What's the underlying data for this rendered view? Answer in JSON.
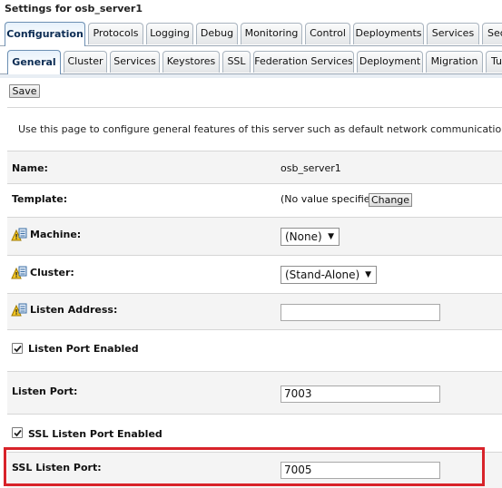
{
  "window": {
    "title": "Settings for osb_server1"
  },
  "tabs_primary": [
    {
      "label": "Configuration",
      "active": true
    },
    {
      "label": "Protocols",
      "active": false
    },
    {
      "label": "Logging",
      "active": false
    },
    {
      "label": "Debug",
      "active": false
    },
    {
      "label": "Monitoring",
      "active": false
    },
    {
      "label": "Control",
      "active": false
    },
    {
      "label": "Deployments",
      "active": false
    },
    {
      "label": "Services",
      "active": false
    },
    {
      "label": "Sec",
      "active": false
    }
  ],
  "tabs_secondary": [
    {
      "label": "General",
      "active": true
    },
    {
      "label": "Cluster",
      "active": false
    },
    {
      "label": "Services",
      "active": false
    },
    {
      "label": "Keystores",
      "active": false
    },
    {
      "label": "SSL",
      "active": false
    },
    {
      "label": "Federation Services",
      "active": false
    },
    {
      "label": "Deployment",
      "active": false
    },
    {
      "label": "Migration",
      "active": false
    },
    {
      "label": "Tu",
      "active": false
    }
  ],
  "toolbar": {
    "save_label": "Save"
  },
  "description": "Use this page to configure general features of this server such as default network communications.",
  "form": {
    "name": {
      "label": "Name:",
      "value": "osb_server1"
    },
    "template": {
      "label": "Template:",
      "value": "(No value specified)",
      "change_label": "Change"
    },
    "machine": {
      "label": "Machine:",
      "value": "(None)",
      "icon": "config-change-icon"
    },
    "cluster": {
      "label": "Cluster:",
      "value": "(Stand-Alone)",
      "icon": "config-change-icon"
    },
    "listen_address": {
      "label": "Listen Address:",
      "value": "",
      "icon": "config-change-icon"
    },
    "listen_port_enabled": {
      "label": "Listen Port Enabled",
      "checked": true
    },
    "listen_port": {
      "label": "Listen Port:",
      "value": "7003"
    },
    "ssl_listen_port_enabled": {
      "label": "SSL Listen Port Enabled",
      "checked": true
    },
    "ssl_listen_port": {
      "label": "SSL Listen Port:",
      "value": "7005"
    }
  },
  "colors": {
    "highlight": "#d8232a",
    "active_tab_text": "#0d2d54"
  }
}
